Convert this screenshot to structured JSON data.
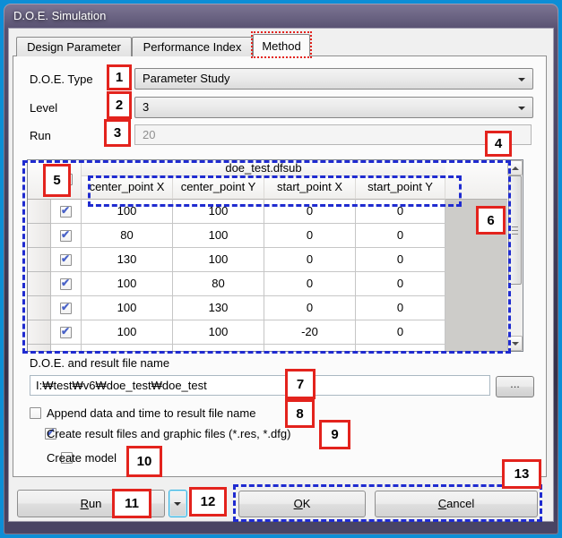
{
  "colors": {
    "frame_border_blue": "#0d8ed6",
    "titlebar_purple": "#403b59",
    "annotation_red": "#e3231d",
    "annotation_blue": "#1f2bd0",
    "checkmark_blue": "#4a63c8",
    "dialog_background": "#f0f0f0"
  },
  "window": {
    "title": "D.O.E. Simulation"
  },
  "tabs": [
    {
      "label": "Design Parameter",
      "active": false
    },
    {
      "label": "Performance Index",
      "active": false
    },
    {
      "label": "Method",
      "active": true
    }
  ],
  "form": {
    "doe_type": {
      "label": "D.O.E. Type",
      "value": "Parameter Study"
    },
    "level": {
      "label": "Level",
      "value": "3"
    },
    "run": {
      "label": "Run",
      "value": "20",
      "disabled": true
    }
  },
  "table": {
    "group_header": "doe_test.dfsub",
    "header_checked": true,
    "columns": [
      "center_point X",
      "center_point Y",
      "start_point X",
      "start_point Y"
    ],
    "rows": [
      {
        "checked": true,
        "cells": [
          "100",
          "100",
          "0",
          "0"
        ]
      },
      {
        "checked": true,
        "cells": [
          "80",
          "100",
          "0",
          "0"
        ]
      },
      {
        "checked": true,
        "cells": [
          "130",
          "100",
          "0",
          "0"
        ]
      },
      {
        "checked": true,
        "cells": [
          "100",
          "80",
          "0",
          "0"
        ]
      },
      {
        "checked": true,
        "cells": [
          "100",
          "130",
          "0",
          "0"
        ]
      },
      {
        "checked": true,
        "cells": [
          "100",
          "100",
          "-20",
          "0"
        ]
      }
    ]
  },
  "file_section": {
    "label": "D.O.E. and result file name",
    "value": "I:₩test₩v6₩doe_test₩doe_test",
    "browse_label": "..."
  },
  "options": [
    {
      "label": "Append data and time to result file name",
      "checked": false
    },
    {
      "label": "Create result files and graphic files (*.res, *.dfg)",
      "checked": true
    },
    {
      "label": "Create model",
      "checked": false
    }
  ],
  "buttons": {
    "run": "Run",
    "ok": "OK",
    "cancel": "Cancel"
  },
  "annotations": {
    "callouts": [
      "1",
      "2",
      "3",
      "4",
      "5",
      "6",
      "7",
      "8",
      "9",
      "10",
      "11",
      "12",
      "13"
    ]
  }
}
